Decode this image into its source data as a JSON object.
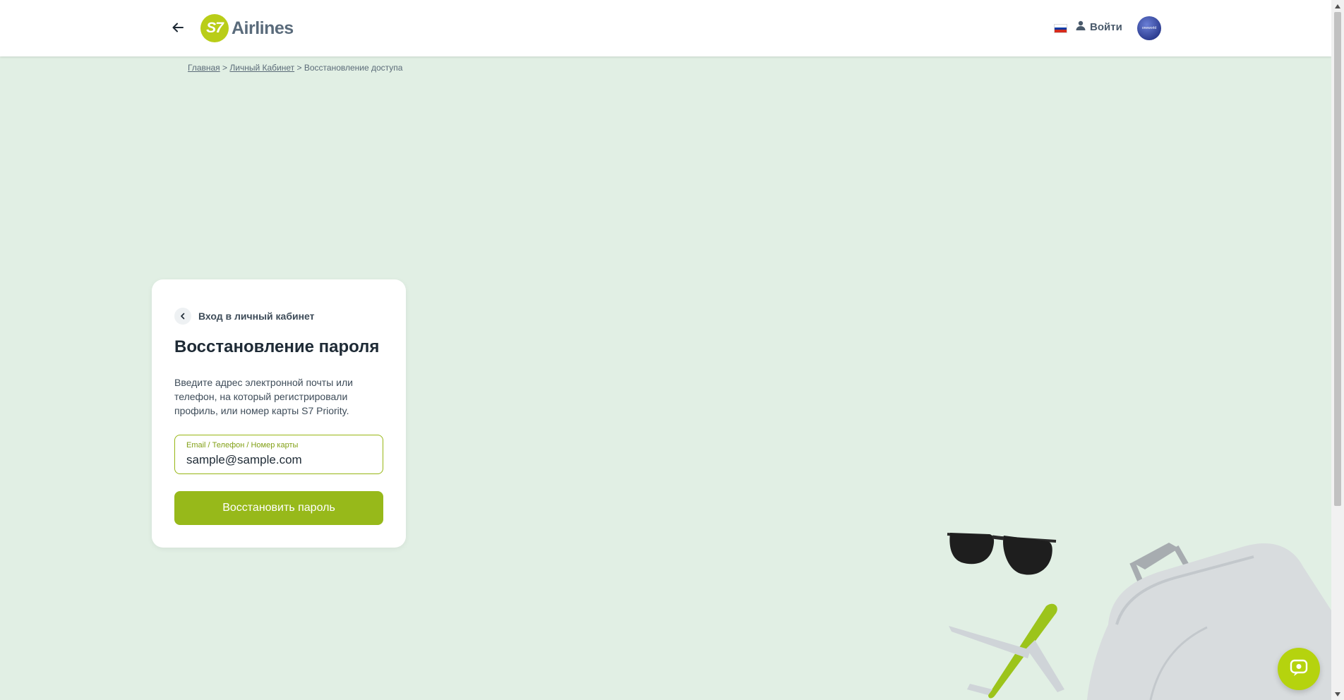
{
  "header": {
    "logo_mark": "S7",
    "logo_text": "Airlines",
    "login_label": "Войти",
    "oneworld_label": "oneworld",
    "flag_colors": [
      "#ffffff",
      "#0039a6",
      "#d52b1e"
    ]
  },
  "breadcrumb": {
    "items": [
      "Главная",
      "Личный Кабинет"
    ],
    "separator": ">",
    "current": "Восстановление доступа"
  },
  "card": {
    "back_label": "Вход в личный кабинет",
    "title": "Восстановление пароля",
    "description": "Введите адрес электронной почты или телефон, на который регистрировали профиль, или номер карты S7 Priority.",
    "field_label": "Email / Телефон / Номер карты",
    "field_value": "sample@sample.com",
    "submit_label": "Восстановить пароль"
  },
  "colors": {
    "accent": "#97b91a",
    "brand_logo": "#b9cd18",
    "page_background": "#e1efe4"
  },
  "icons": {
    "back": "arrow-left-icon",
    "card_back": "chevron-left-icon",
    "user": "user-icon",
    "chat": "chat-icon"
  }
}
